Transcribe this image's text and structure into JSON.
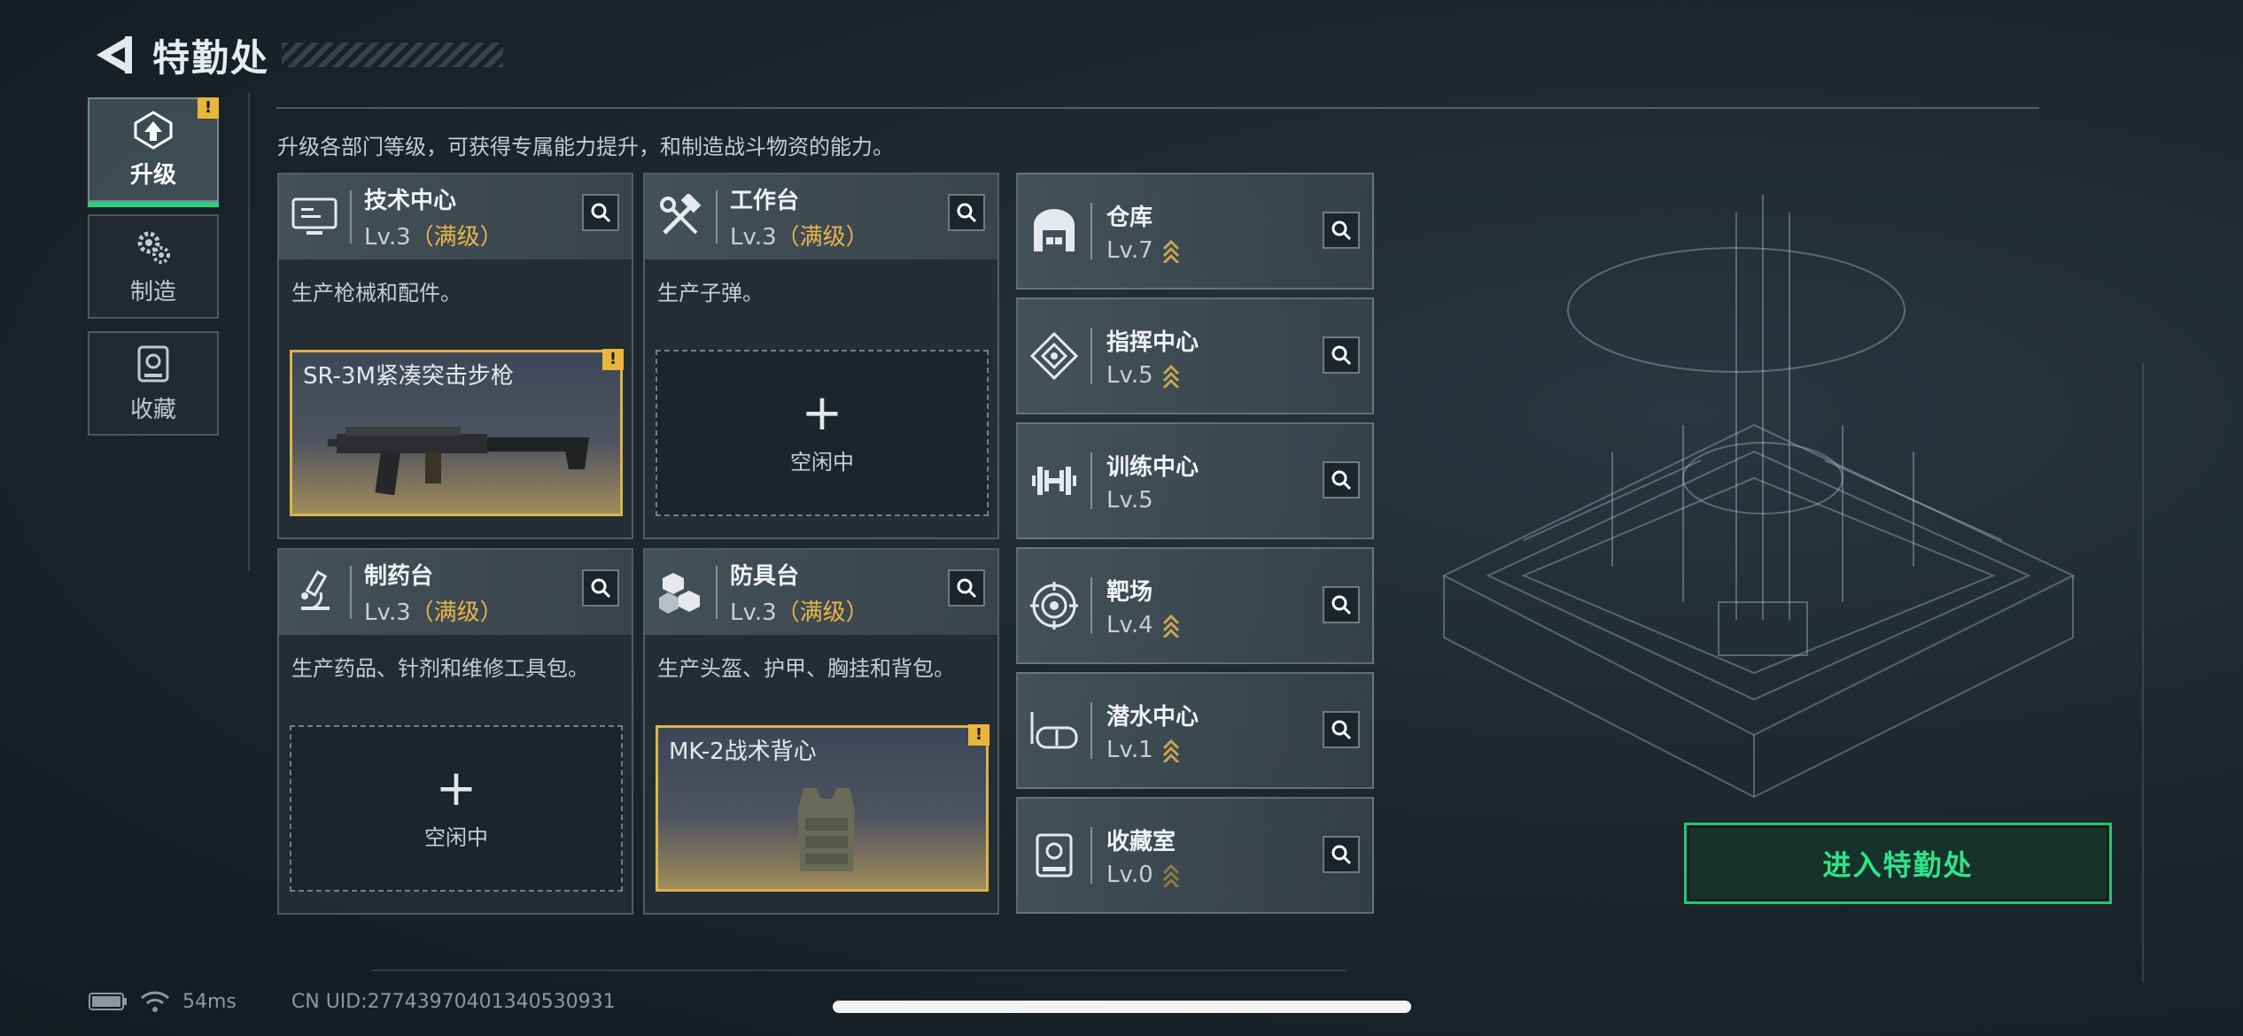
{
  "header": {
    "title": "特勤处"
  },
  "nav": [
    {
      "label": "升级",
      "active": true,
      "alert": "!"
    },
    {
      "label": "制造",
      "active": false
    },
    {
      "label": "收藏",
      "active": false
    }
  ],
  "description": "升级各部门等级，可获得专属能力提升，和制造战斗物资的能力。",
  "departments": [
    {
      "name": "技术中心",
      "level": "Lv.3",
      "max_label": "（满级）",
      "desc": "生产枪械和配件。",
      "slot_item": "SR-3M紧凑突击步枪",
      "alert": "!"
    },
    {
      "name": "工作台",
      "level": "Lv.3",
      "max_label": "（满级）",
      "desc": "生产子弹。",
      "slot_empty": "空闲中",
      "plus": "+"
    },
    {
      "name": "制药台",
      "level": "Lv.3",
      "max_label": "（满级）",
      "desc": "生产药品、针剂和维修工具包。",
      "slot_empty": "空闲中",
      "plus": "+"
    },
    {
      "name": "防具台",
      "level": "Lv.3",
      "max_label": "（满级）",
      "desc": "生产头盔、护甲、胸挂和背包。",
      "slot_item": "MK-2战术背心",
      "alert": "!"
    }
  ],
  "facilities": [
    {
      "name": "仓库",
      "level": "Lv.7",
      "upgradable": true,
      "icon": "warehouse-icon"
    },
    {
      "name": "指挥中心",
      "level": "Lv.5",
      "upgradable": true,
      "icon": "command-icon"
    },
    {
      "name": "训练中心",
      "level": "Lv.5",
      "upgradable": false,
      "icon": "dumbbell-icon"
    },
    {
      "name": "靶场",
      "level": "Lv.4",
      "upgradable": true,
      "icon": "target-icon"
    },
    {
      "name": "潜水中心",
      "level": "Lv.1",
      "upgradable": true,
      "icon": "diving-mask-icon"
    },
    {
      "name": "收藏室",
      "level": "Lv.0",
      "upgradable": true,
      "icon": "collection-icon"
    }
  ],
  "enter_button": "进入特勤处",
  "status": {
    "ping": "54ms",
    "uid": "CN UID:27743970401340530931"
  },
  "colors": {
    "accent": "#2ad27f",
    "max_level": "#e7b64a",
    "alert": "#e8b63b"
  }
}
